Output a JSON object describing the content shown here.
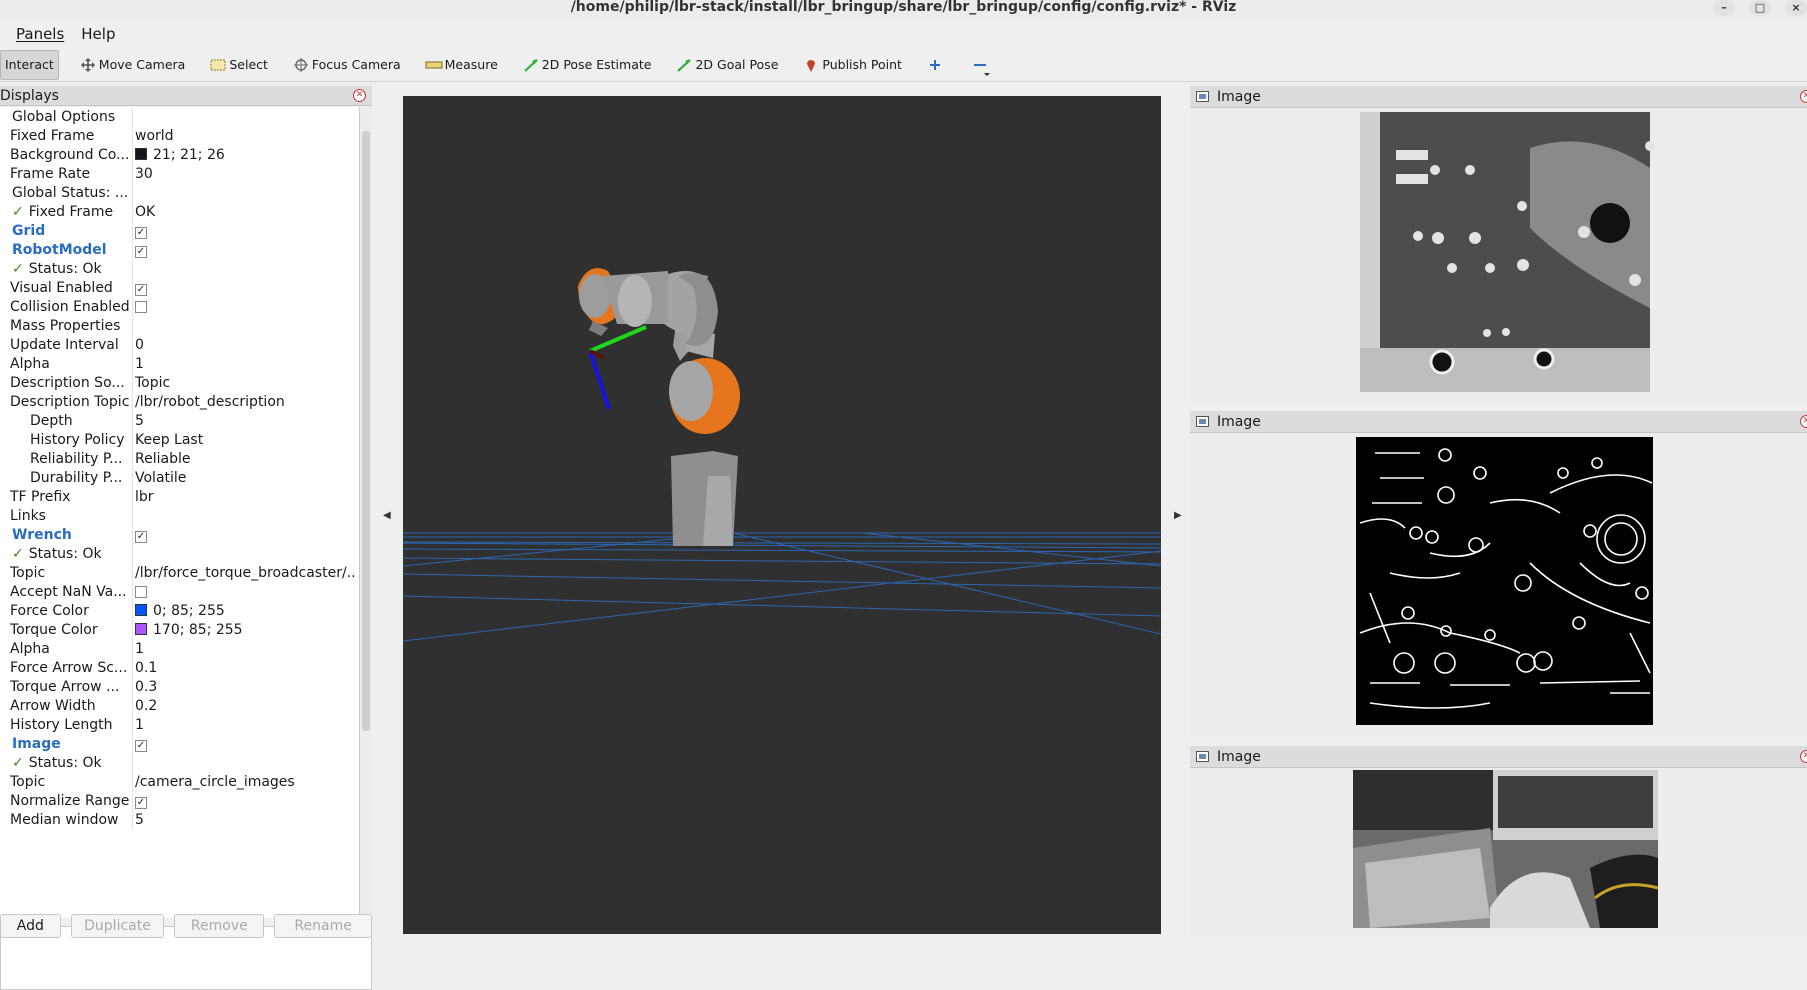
{
  "window": {
    "title": "/home/philip/lbr-stack/install/lbr_bringup/share/lbr_bringup/config/config.rviz* - RViz",
    "minimize": "–",
    "maximize": "□",
    "close": "×"
  },
  "menu": [
    "Panels",
    "Help"
  ],
  "toolbar": [
    {
      "label": "Interact",
      "icon": "interact-icon"
    },
    {
      "label": "Move Camera",
      "icon": "move-camera-icon"
    },
    {
      "label": "Select",
      "icon": "select-icon"
    },
    {
      "label": "Focus Camera",
      "icon": "focus-camera-icon"
    },
    {
      "label": "Measure",
      "icon": "measure-icon"
    },
    {
      "label": "2D Pose Estimate",
      "icon": "pose-estimate-icon"
    },
    {
      "label": "2D Goal Pose",
      "icon": "goal-pose-icon"
    },
    {
      "label": "Publish Point",
      "icon": "publish-point-icon"
    },
    {
      "label": "",
      "icon": "plus-icon"
    },
    {
      "label": "",
      "icon": "minus-icon"
    }
  ],
  "displays": {
    "title": "Displays",
    "rows": [
      {
        "k": "Global Options",
        "v": "",
        "ind": 0,
        "type": "header"
      },
      {
        "k": "Fixed Frame",
        "v": "world",
        "ind": 1
      },
      {
        "k": "Background Co...",
        "v": "21; 21; 26",
        "ind": 1,
        "swatch": "#15151a"
      },
      {
        "k": "Frame Rate",
        "v": "30",
        "ind": 1
      },
      {
        "k": "Global Status: ...",
        "v": "",
        "ind": 0
      },
      {
        "k": "Fixed Frame",
        "v": "OK",
        "ind": 1,
        "check": true
      },
      {
        "k": "Grid",
        "v": "",
        "ind": 0,
        "blue": true,
        "cb": true
      },
      {
        "k": "RobotModel",
        "v": "",
        "ind": 0,
        "blue": true,
        "cb": true
      },
      {
        "k": "Status: Ok",
        "v": "",
        "ind": 1,
        "check": true
      },
      {
        "k": "Visual Enabled",
        "v": "",
        "ind": 1,
        "cb": true
      },
      {
        "k": "Collision Enabled",
        "v": "",
        "ind": 1,
        "cb": false
      },
      {
        "k": "Mass Properties",
        "v": "",
        "ind": 1
      },
      {
        "k": "Update Interval",
        "v": "0",
        "ind": 1
      },
      {
        "k": "Alpha",
        "v": "1",
        "ind": 1
      },
      {
        "k": "Description So...",
        "v": "Topic",
        "ind": 1
      },
      {
        "k": "Description Topic",
        "v": "/lbr/robot_description",
        "ind": 1
      },
      {
        "k": "Depth",
        "v": "5",
        "ind": 2
      },
      {
        "k": "History Policy",
        "v": "Keep Last",
        "ind": 2
      },
      {
        "k": "Reliability P...",
        "v": "Reliable",
        "ind": 2
      },
      {
        "k": "Durability P...",
        "v": "Volatile",
        "ind": 2
      },
      {
        "k": "TF Prefix",
        "v": "lbr",
        "ind": 1
      },
      {
        "k": "Links",
        "v": "",
        "ind": 1
      },
      {
        "k": "Wrench",
        "v": "",
        "ind": 0,
        "blue": true,
        "cb": true
      },
      {
        "k": "Status: Ok",
        "v": "",
        "ind": 1,
        "check": true
      },
      {
        "k": "Topic",
        "v": "/lbr/force_torque_broadcaster/...",
        "ind": 1
      },
      {
        "k": "Accept NaN Va...",
        "v": "",
        "ind": 1,
        "cb": false
      },
      {
        "k": "Force Color",
        "v": "0; 85; 255",
        "ind": 1,
        "swatch": "#0055ff"
      },
      {
        "k": "Torque Color",
        "v": "170; 85; 255",
        "ind": 1,
        "swatch": "#aa55ff"
      },
      {
        "k": "Alpha",
        "v": "1",
        "ind": 1
      },
      {
        "k": "Force Arrow Sc...",
        "v": "0.1",
        "ind": 1
      },
      {
        "k": "Torque Arrow ...",
        "v": "0.3",
        "ind": 1
      },
      {
        "k": "Arrow Width",
        "v": "0.2",
        "ind": 1
      },
      {
        "k": "History Length",
        "v": "1",
        "ind": 1
      },
      {
        "k": "Image",
        "v": "",
        "ind": 0,
        "blue": true,
        "cb": true
      },
      {
        "k": "Status: Ok",
        "v": "",
        "ind": 1,
        "check": true
      },
      {
        "k": "Topic",
        "v": "/camera_circle_images",
        "ind": 1
      },
      {
        "k": "Normalize Range",
        "v": "",
        "ind": 1,
        "cb": true
      },
      {
        "k": "Median window",
        "v": "5",
        "ind": 1
      }
    ]
  },
  "buttons": {
    "add": "Add",
    "duplicate": "Duplicate",
    "remove": "Remove",
    "rename": "Rename"
  },
  "image_panels": [
    {
      "title": "Image"
    },
    {
      "title": "Image"
    },
    {
      "title": "Image"
    }
  ],
  "colors": {
    "viewport_bg": "#303030",
    "grid": "#2a6cc2",
    "robot_orange": "#e5761e",
    "robot_grey": "#9a9a9a"
  }
}
